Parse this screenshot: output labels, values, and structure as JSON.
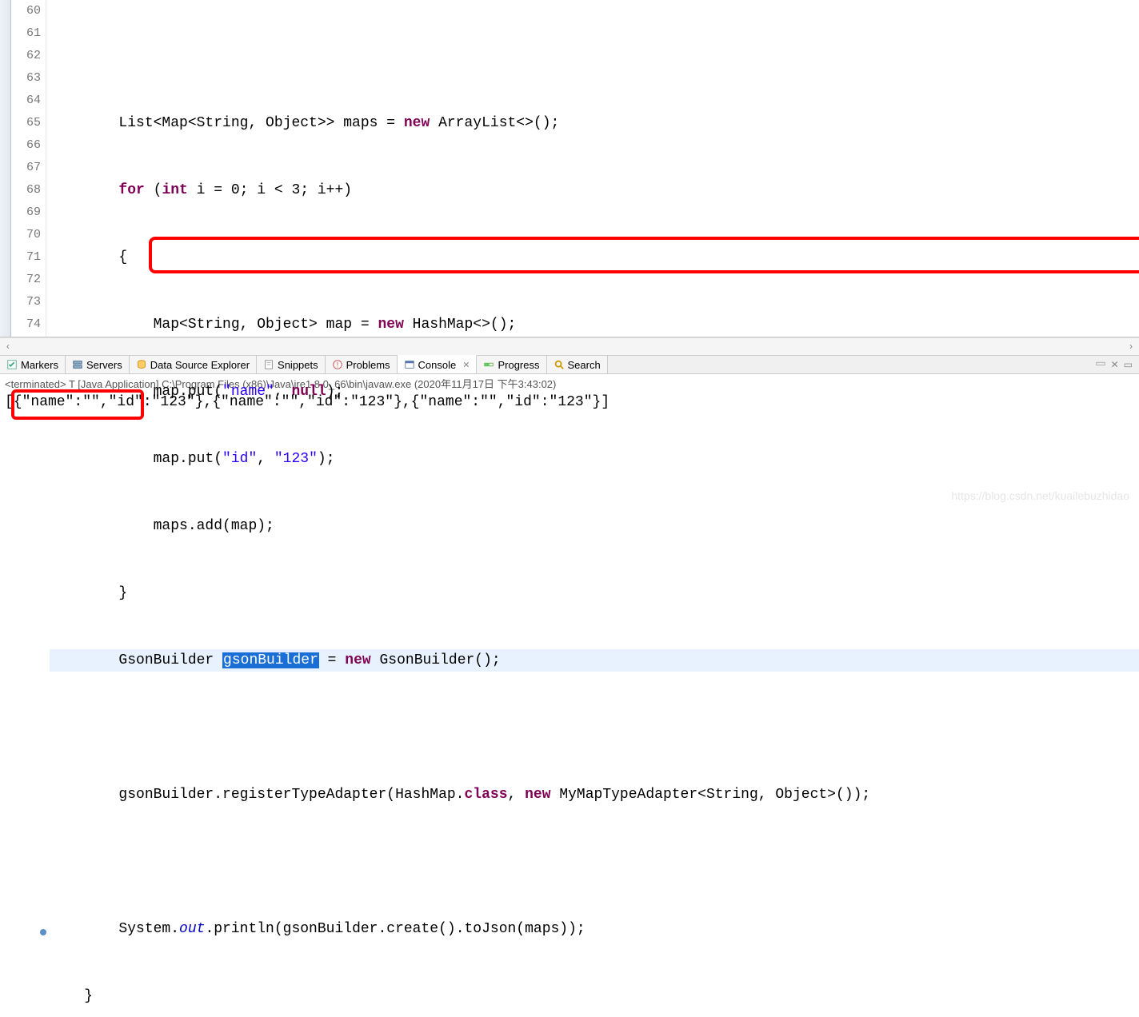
{
  "gutter": {
    "start": 60,
    "end": 74
  },
  "code": {
    "l60": "",
    "l61_a": "        List<Map<String, Object>> maps = ",
    "l61_new": "new",
    "l61_b": " ArrayList<>();",
    "l62_a": "        ",
    "l62_for": "for",
    "l62_b": " (",
    "l62_int": "int",
    "l62_c": " i = 0; i < 3; i++)",
    "l63": "        {",
    "l64_a": "            Map<String, Object> map = ",
    "l64_new": "new",
    "l64_b": " HashMap<>();",
    "l65_a": "            map.put(",
    "l65_s1": "\"name\"",
    "l65_b": ", ",
    "l65_null": "null",
    "l65_c": ");",
    "l66_a": "            map.put(",
    "l66_s1": "\"id\"",
    "l66_b": ", ",
    "l66_s2": "\"123\"",
    "l66_c": ");",
    "l67": "            maps.add(map);",
    "l68": "        }",
    "l69_a": "        GsonBuilder ",
    "l69_sel": "gsonBuilder",
    "l69_b": " = ",
    "l69_new": "new",
    "l69_c": " GsonBuilder();",
    "l70": "",
    "l71_a": "        gsonBuilder.registerTypeAdapter(HashMap.",
    "l71_class": "class",
    "l71_b": ", ",
    "l71_new": "new",
    "l71_c": " MyMapTypeAdapter<String, Object>());",
    "l72": "",
    "l73_a": "        System.",
    "l73_out": "out",
    "l73_b": ".println(gsonBuilder.create().toJson(maps));",
    "l74": "    }"
  },
  "tabs": {
    "markers": "Markers",
    "servers": "Servers",
    "dse": "Data Source Explorer",
    "snippets": "Snippets",
    "problems": "Problems",
    "console": "Console",
    "progress": "Progress",
    "search": "Search"
  },
  "console": {
    "header": "<terminated> T [Java Application] C:\\Program Files (x86)\\Java\\jre1.8.0_66\\bin\\javaw.exe (2020年11月17日 下午3:43:02)",
    "output": "[{\"name\":\"\",\"id\":\"123\"},{\"name\":\"\",\"id\":\"123\"},{\"name\":\"\",\"id\":\"123\"}]"
  },
  "watermark": "https://blog.csdn.net/kuailebuzhidao",
  "icons": {
    "close_tab": "✕",
    "pin": "📌",
    "min": "▭",
    "max": "▢"
  }
}
